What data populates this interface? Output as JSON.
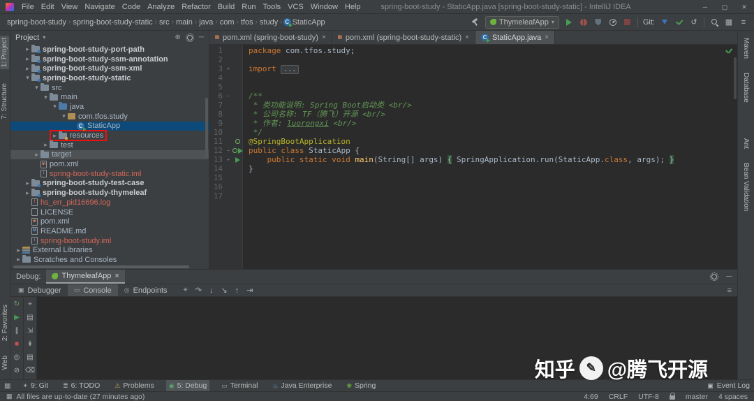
{
  "glyphs": {
    "collapsed": "▸",
    "expanded": "▾",
    "chevron": "›",
    "close_tab": "×",
    "minimize": "─",
    "maximize": "▢",
    "close_window": "✕",
    "dropdown": "▾",
    "revert": "↺",
    "list": "≡",
    "layout": "▦",
    "collapse_all": "⊟",
    "locate": "⊕",
    "corner": "▦",
    "event_log": "▣"
  },
  "icon_glyphs": {
    "maven-file": "m",
    "iml-file": "i",
    "md-file": "M",
    "log-file": "!",
    "text-file": "",
    "class-run": "C",
    "library": "",
    "scratches": "",
    "module": "",
    "folder": "",
    "src-folder": "",
    "res-folder": "",
    "package": ""
  },
  "title_bar": {
    "title": "spring-boot-study - StaticApp.java [spring-boot-study-static] - IntelliJ IDEA",
    "menu": [
      "File",
      "Edit",
      "View",
      "Navigate",
      "Code",
      "Analyze",
      "Refactor",
      "Build",
      "Run",
      "Tools",
      "VCS",
      "Window",
      "Help"
    ]
  },
  "nav_bar": {
    "breadcrumb": [
      "spring-boot-study",
      "spring-boot-study-static",
      "src",
      "main",
      "java",
      "com",
      "tfos",
      "study",
      "StaticApp"
    ],
    "run_config": "ThymeleafApp",
    "git_label": "Git:"
  },
  "left_stripe": {
    "top": [
      {
        "label": "1: Project",
        "active": true
      },
      {
        "label": "7: Structure"
      }
    ],
    "bottom": [
      {
        "label": "2: Favorites"
      },
      {
        "label": "Web"
      }
    ]
  },
  "right_stripe": [
    {
      "label": "Maven"
    },
    {
      "label": "Database"
    },
    {
      "label": "Ant",
      "gap": true
    },
    {
      "label": "Bean Validation"
    }
  ],
  "project_panel": {
    "title": "Project",
    "tree": [
      {
        "depth": 1,
        "icon": "module",
        "arrow": "collapsed",
        "label": "spring-boot-study-port-path",
        "bold": true
      },
      {
        "depth": 1,
        "icon": "module",
        "arrow": "collapsed",
        "label": "spring-boot-study-ssm-annotation",
        "bold": true
      },
      {
        "depth": 1,
        "icon": "module",
        "arrow": "collapsed",
        "label": "spring-boot-study-ssm-xml",
        "bold": true
      },
      {
        "depth": 1,
        "icon": "module",
        "arrow": "expanded",
        "label": "spring-boot-study-static",
        "bold": true
      },
      {
        "depth": 2,
        "icon": "folder",
        "arrow": "expanded",
        "label": "src"
      },
      {
        "depth": 3,
        "icon": "folder",
        "arrow": "expanded",
        "label": "main"
      },
      {
        "depth": 4,
        "icon": "src-folder",
        "arrow": "expanded",
        "label": "java"
      },
      {
        "depth": 5,
        "icon": "package",
        "arrow": "expanded",
        "label": "com.tfos.study"
      },
      {
        "depth": 6,
        "icon": "class-run",
        "arrow": "none",
        "label": "StaticApp",
        "selected": true
      },
      {
        "depth": 4,
        "icon": "res-folder",
        "arrow": "collapsed",
        "label": "resources",
        "red_box": true
      },
      {
        "depth": 3,
        "icon": "folder",
        "arrow": "collapsed",
        "label": "test"
      },
      {
        "depth": 2,
        "icon": "folder",
        "arrow": "collapsed",
        "label": "target",
        "hovered": true
      },
      {
        "depth": 2,
        "icon": "maven-file",
        "arrow": "none",
        "label": "pom.xml"
      },
      {
        "depth": 2,
        "icon": "iml-file",
        "arrow": "none",
        "label": "spring-boot-study-static.iml",
        "vcs": "red"
      },
      {
        "depth": 1,
        "icon": "module",
        "arrow": "collapsed",
        "label": "spring-boot-study-test-case",
        "bold": true
      },
      {
        "depth": 1,
        "icon": "module",
        "arrow": "collapsed",
        "label": "spring-boot-study-thymeleaf",
        "bold": true
      },
      {
        "depth": 1,
        "icon": "log-file",
        "arrow": "none",
        "label": "hs_err_pid16696.log",
        "vcs": "red"
      },
      {
        "depth": 1,
        "icon": "text-file",
        "arrow": "none",
        "label": "LICENSE"
      },
      {
        "depth": 1,
        "icon": "maven-file",
        "arrow": "none",
        "label": "pom.xml"
      },
      {
        "depth": 1,
        "icon": "md-file",
        "arrow": "none",
        "label": "README.md"
      },
      {
        "depth": 1,
        "icon": "iml-file",
        "arrow": "none",
        "label": "spring-boot-study.iml",
        "vcs": "red"
      },
      {
        "depth": 0,
        "icon": "library",
        "arrow": "collapsed",
        "label": "External Libraries"
      },
      {
        "depth": 0,
        "icon": "scratches",
        "arrow": "collapsed",
        "label": "Scratches and Consoles"
      }
    ]
  },
  "editor": {
    "tabs": [
      {
        "label": "pom.xml (spring-boot-study)",
        "icon": "maven",
        "active": false
      },
      {
        "label": "pom.xml (spring-boot-study-static)",
        "icon": "maven",
        "active": false
      },
      {
        "label": "StaticApp.java",
        "icon": "class-run",
        "active": true
      }
    ],
    "code": [
      {
        "n": 1,
        "segs": [
          {
            "t": "package ",
            "s": "kw"
          },
          {
            "t": "com.tfos.study;",
            "s": "pl"
          }
        ]
      },
      {
        "n": 2,
        "segs": []
      },
      {
        "n": 3,
        "fold": "+",
        "segs": [
          {
            "t": "import ",
            "s": "kw"
          },
          {
            "t": "...",
            "s": "foldph"
          }
        ]
      },
      {
        "n": 4,
        "segs": []
      },
      {
        "n": 5,
        "segs": []
      },
      {
        "n": 6,
        "fold": "−",
        "segs": [
          {
            "t": "/**",
            "s": "doc"
          }
        ]
      },
      {
        "n": 7,
        "segs": [
          {
            "t": " * 类功能说明: Spring Boot启动类 <br/>",
            "s": "doc"
          }
        ]
      },
      {
        "n": 8,
        "segs": [
          {
            "t": " * 公司名称: TF（腾飞）开源 <br/>",
            "s": "doc"
          }
        ]
      },
      {
        "n": 9,
        "segs": [
          {
            "t": " * 作者: ",
            "s": "doc"
          },
          {
            "t": "luorongxi",
            "s": "doclink"
          },
          {
            "t": " <br/>",
            "s": "doc"
          }
        ]
      },
      {
        "n": 10,
        "segs": [
          {
            "t": " */",
            "s": "doc"
          }
        ]
      },
      {
        "n": 11,
        "gutter": "bean",
        "segs": [
          {
            "t": "@SpringBootApplication",
            "s": "ann"
          }
        ]
      },
      {
        "n": 12,
        "fold": "−",
        "gutter": "run-class",
        "segs": [
          {
            "t": "public class ",
            "s": "kw"
          },
          {
            "t": "StaticApp {",
            "s": "pl"
          }
        ]
      },
      {
        "n": 13,
        "fold": "+",
        "gutter": "run-main",
        "segs": [
          {
            "t": "    ",
            "s": "pl"
          },
          {
            "t": "public static void ",
            "s": "kw"
          },
          {
            "t": "main",
            "s": "method"
          },
          {
            "t": "(String[] args) ",
            "s": "pl"
          },
          {
            "t": "{",
            "s": "foldbrace"
          },
          {
            "t": " SpringApplication.run(StaticApp.",
            "s": "pl"
          },
          {
            "t": "class",
            "s": "kw"
          },
          {
            "t": ", args); ",
            "s": "pl"
          },
          {
            "t": "}",
            "s": "foldbrace"
          }
        ]
      },
      {
        "n": 14,
        "segs": [
          {
            "t": "}",
            "s": "pl"
          }
        ]
      },
      {
        "n": 15,
        "segs": []
      },
      {
        "n": 16,
        "segs": []
      },
      {
        "n": 17,
        "segs": []
      }
    ]
  },
  "debug_panel": {
    "label": "Debug:",
    "session_tab": "ThymeleafApp",
    "tabs": [
      {
        "label": "Debugger",
        "glyph": "▣",
        "active": false
      },
      {
        "label": "Console",
        "glyph": "▭",
        "active": true
      },
      {
        "label": "Endpoints",
        "glyph": "◎",
        "active": false
      }
    ],
    "step_icons": [
      {
        "name": "show-execution-point-icon",
        "glyph": "⌖"
      },
      {
        "name": "step-over-icon",
        "glyph": "↷"
      },
      {
        "name": "step-into-icon",
        "glyph": "↓"
      },
      {
        "name": "force-step-into-icon",
        "glyph": "↘"
      },
      {
        "name": "step-out-icon",
        "glyph": "↑"
      },
      {
        "name": "run-to-cursor-icon",
        "glyph": "⇥"
      }
    ],
    "left_col1": [
      {
        "name": "rerun-icon",
        "glyph": "↻",
        "color": "#6ba065"
      },
      {
        "name": "resume-icon",
        "glyph": "▶",
        "color": "#499c54"
      },
      {
        "name": "pause-icon",
        "glyph": "∥"
      },
      {
        "name": "stop-icon",
        "glyph": "■",
        "color": "#c75450"
      },
      {
        "name": "view-breakpoints-icon",
        "glyph": "◎"
      },
      {
        "name": "mute-breakpoints-icon",
        "glyph": "⊘"
      }
    ],
    "left_col2": [
      {
        "name": "hide-frames-icon",
        "glyph": "⌖"
      },
      {
        "name": "restore-layout-icon",
        "glyph": "▤"
      },
      {
        "name": "pin-tab-icon",
        "glyph": "⇲"
      },
      {
        "name": "scroll-to-end-icon",
        "glyph": "⇟"
      },
      {
        "name": "print-icon",
        "glyph": "▤"
      },
      {
        "name": "clear-all-icon",
        "glyph": "⌫"
      }
    ]
  },
  "tool_window_bar": {
    "items": [
      {
        "label": "9: Git",
        "icon": "git-icon",
        "glyph": "✦",
        "color": "#9da0a3"
      },
      {
        "label": "6: TODO",
        "icon": "todo-icon",
        "glyph": "≣",
        "color": "#9da0a3"
      },
      {
        "label": "Problems",
        "icon": "problems-icon",
        "glyph": "⚠",
        "color": "#c7a456"
      },
      {
        "label": "5: Debug",
        "icon": "debug-toolwindow-icon",
        "glyph": "◉",
        "color": "#59a869",
        "active": true
      },
      {
        "label": "Terminal",
        "icon": "terminal-icon",
        "glyph": "▭",
        "color": "#9da0a3"
      },
      {
        "label": "Java Enterprise",
        "icon": "java-enterprise-icon",
        "glyph": "♨",
        "color": "#6a9dcb"
      },
      {
        "label": "Spring",
        "icon": "spring-icon",
        "glyph": "❀",
        "color": "#6db33f"
      }
    ],
    "event_log": "Event Log"
  },
  "status_bar": {
    "message": "All files are up-to-date (27 minutes ago)",
    "position": "4:69",
    "line_ending": "CRLF",
    "encoding": "UTF-8",
    "branch": "master",
    "indent": "4 spaces"
  },
  "watermark": {
    "brand": "知乎",
    "handle": "@腾飞开源",
    "logo_glyph": "✎"
  }
}
